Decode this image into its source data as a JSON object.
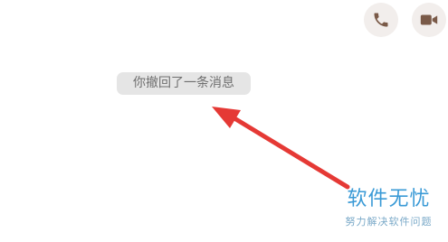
{
  "header": {
    "voice_call_icon": "phone-icon",
    "video_call_icon": "video-camera-icon"
  },
  "chat": {
    "recall_notice": "你撤回了一条消息"
  },
  "annotation": {
    "type": "red-arrow",
    "color": "#e53935",
    "points_to": "recall_notice"
  },
  "watermark": {
    "title": "软件无忧",
    "subtitle": "努力解决软件问题",
    "color": "#3a9ad6"
  },
  "colors": {
    "icon_background": "#f2eeec",
    "icon_foreground": "#7a5a48",
    "notice_background": "#e5e5e5",
    "notice_text": "#6f6f6f"
  }
}
